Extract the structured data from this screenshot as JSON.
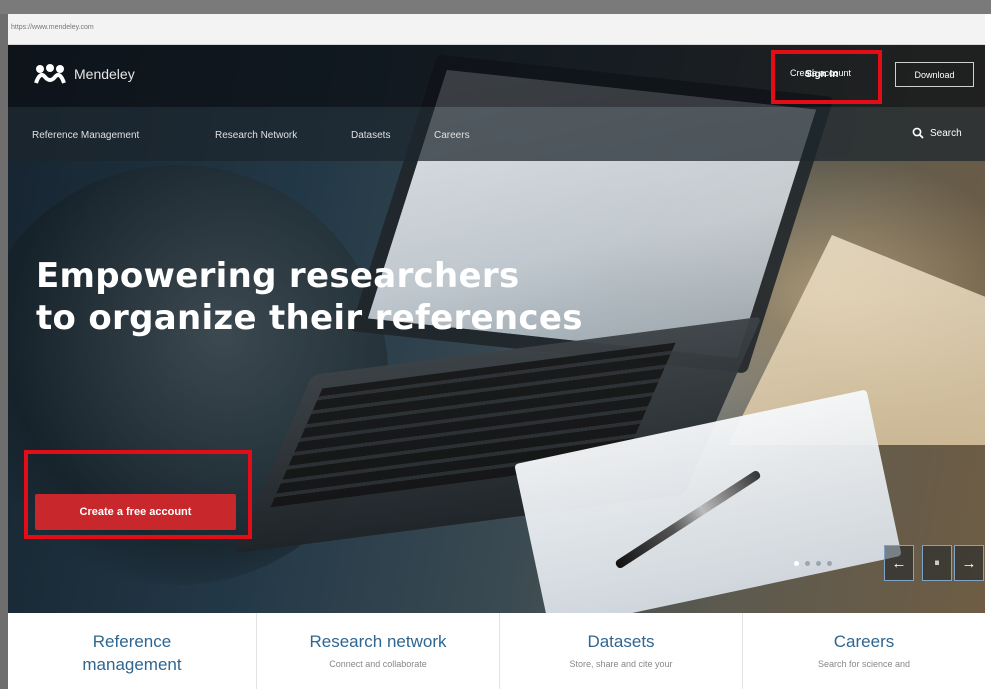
{
  "browser": {
    "url": "https://www.mendeley.com"
  },
  "header": {
    "logo_text": "Mendeley",
    "sign_in": "Sign In",
    "create_account": "Create account",
    "download": "Download"
  },
  "subnav": {
    "items": [
      "Reference Management",
      "Research Network",
      "Datasets",
      "Careers"
    ],
    "search": "Search"
  },
  "hero": {
    "headline_line1": "Empowering researchers",
    "headline_line2": "to organize their references",
    "cta": "Create a free account",
    "carousel": {
      "slides": 4,
      "active": 1,
      "prev_icon": "←",
      "pause_icon": "⏸",
      "next_icon": "→"
    }
  },
  "cards": [
    {
      "title_line1": "Reference",
      "title_line2": "management",
      "text": ""
    },
    {
      "title_line1": "Research network",
      "title_line2": "",
      "text": "Connect and collaborate"
    },
    {
      "title_line1": "Datasets",
      "title_line2": "",
      "text": "Store, share and cite your"
    },
    {
      "title_line1": "Careers",
      "title_line2": "",
      "text": "Search for science and"
    }
  ],
  "colors": {
    "accent_red": "#c8272b",
    "highlight_box": "#e30d17",
    "card_title": "#2f6690"
  }
}
